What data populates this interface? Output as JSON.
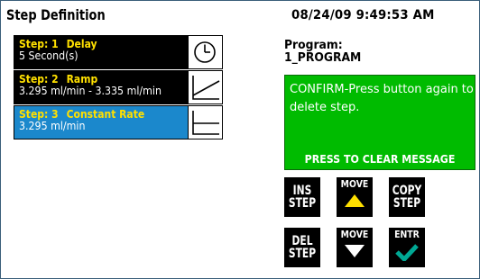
{
  "header": {
    "title": "Step Definition",
    "datetime": "08/24/09 9:49:53 AM"
  },
  "steps": [
    {
      "number": "Step: 1",
      "type": "Delay",
      "detail": "5 Second(s)",
      "icon": "clock-icon",
      "selected": false
    },
    {
      "number": "Step: 2",
      "type": "Ramp",
      "detail": "3.295 ml/min - 3.335 ml/min",
      "icon": "ramp-icon",
      "selected": false
    },
    {
      "number": "Step: 3",
      "type": "Constant Rate",
      "detail": "3.295 ml/min",
      "icon": "constant-rate-icon",
      "selected": true
    }
  ],
  "program": {
    "label": "Program:",
    "name": "1_PROGRAM"
  },
  "message": {
    "text": "CONFIRM-Press button again to delete step.",
    "footer": "PRESS TO CLEAR MESSAGE",
    "color": "#00bb00"
  },
  "buttons": {
    "ins_line1": "INS",
    "ins_line2": "STEP",
    "move_up": "MOVE",
    "copy_line1": "COPY",
    "copy_line2": "STEP",
    "del_line1": "DEL",
    "del_line2": "STEP",
    "move_down": "MOVE",
    "enter": "ENTR"
  },
  "colors": {
    "selected_row": "#1b88cc",
    "step_title": "#ffe000",
    "arrow": "#ffe000",
    "check": "#00a894"
  }
}
